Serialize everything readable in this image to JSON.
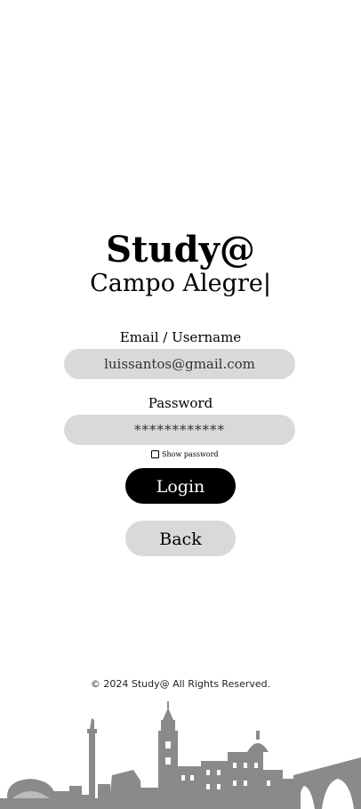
{
  "brand": {
    "title": "Study@",
    "subtitle": "Campo Alegre",
    "cursor": "|"
  },
  "form": {
    "email_label": "Email / Username",
    "email_value": "luissantos@gmail.com",
    "password_label": "Password",
    "password_value": "************",
    "show_password_label": "Show password",
    "show_password_checked": false
  },
  "buttons": {
    "login_label": "Login",
    "back_label": "Back"
  },
  "footer": {
    "copyright": "© 2024 Study@ All Rights Reserved."
  },
  "colors": {
    "field_bg": "#d9d9d9",
    "login_bg": "#000000",
    "back_bg": "#d9d9d9",
    "skyline": "#8a8a8a"
  },
  "icons": {
    "skyline": "porto-city-skyline-illustration"
  }
}
